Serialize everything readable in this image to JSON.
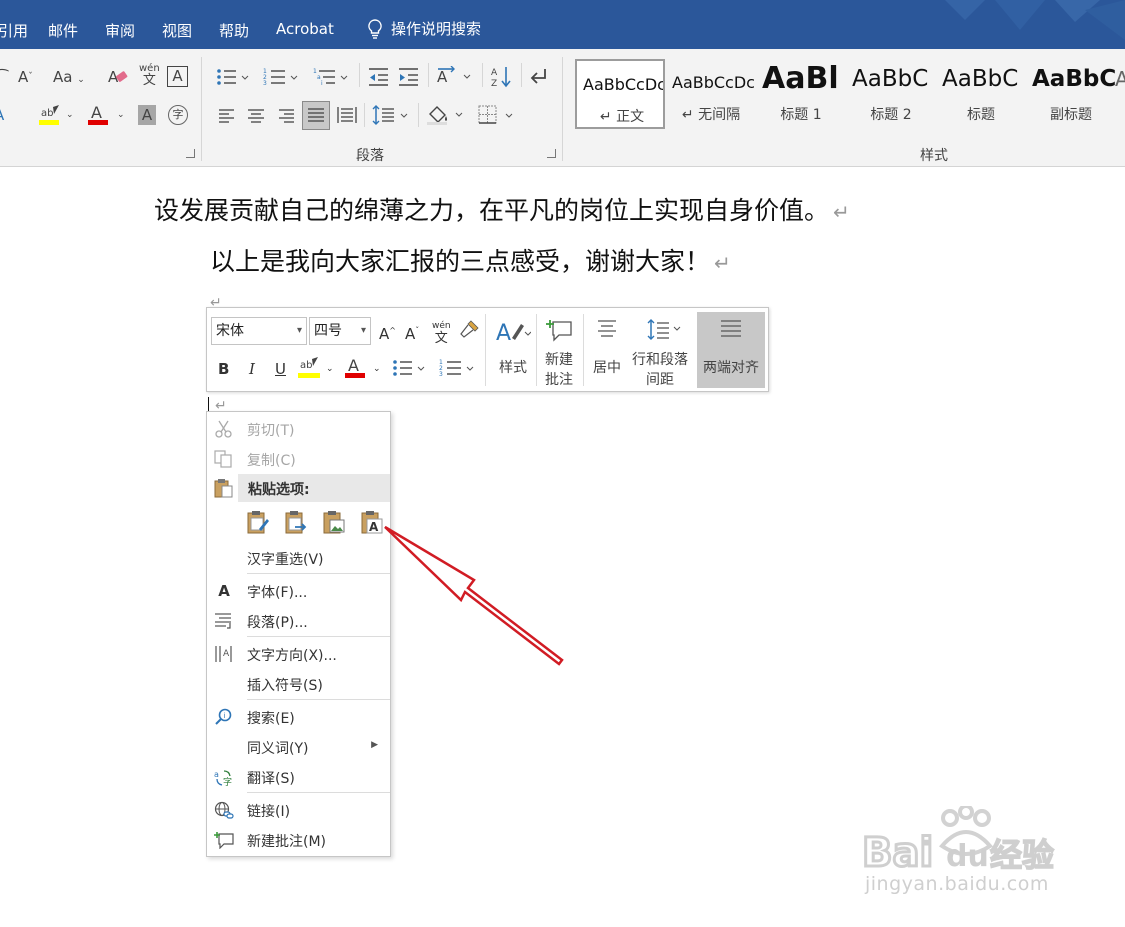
{
  "ribbon": {
    "tabs": [
      "引用",
      "邮件",
      "审阅",
      "视图",
      "帮助",
      "Acrobat"
    ],
    "tell_me": "操作说明搜索",
    "groups": {
      "paragraph_label": "段落",
      "styles_label": "样式"
    },
    "font_icons": {
      "shrink": "A",
      "case": "Aa",
      "pinyin_top": "wén",
      "pinyin_bottom": "文",
      "border_char": "A",
      "font_color": "A",
      "shade": "A",
      "enclose": "字"
    },
    "styles": [
      {
        "sample": "AaBbCcDc",
        "name": "↵ 正文",
        "selected": true
      },
      {
        "sample": "AaBbCcDc",
        "name": "↵ 无间隔",
        "selected": false
      },
      {
        "sample": "AaBl",
        "name": "标题 1",
        "selected": false
      },
      {
        "sample": "AaBbC",
        "name": "标题 2",
        "selected": false
      },
      {
        "sample": "AaBbC",
        "name": "标题",
        "selected": false
      },
      {
        "sample": "AaBbC",
        "name": "副标题",
        "selected": false
      }
    ]
  },
  "document": {
    "line1": "设发展贡献自己的绵薄之力，在平凡的岗位上实现自身价值。",
    "line2": "以上是我向大家汇报的三点感受，谢谢大家！",
    "para_mark": "↵"
  },
  "mini_toolbar": {
    "font_name": "宋体",
    "font_size": "四号",
    "grow": "A",
    "shrink": "A",
    "pinyin_top": "wén",
    "pinyin_bottom": "文",
    "bold": "B",
    "italic": "I",
    "underline": "U",
    "font_color": "A",
    "styles_label": "样式",
    "new_comment_label": "新建\n批注",
    "center_label": "居中",
    "spacing_label": "行和段落\n间距",
    "justify_label": "两端对齐"
  },
  "context_menu": {
    "cut": "剪切(T)",
    "copy": "复制(C)",
    "paste_options": "粘贴选项:",
    "reconvert": "汉字重选(V)",
    "font": "字体(F)...",
    "paragraph": "段落(P)...",
    "text_direction": "文字方向(X)...",
    "insert_symbol": "插入符号(S)",
    "search": "搜索(E)",
    "synonyms": "同义词(Y)",
    "translate": "翻译(S)",
    "link": "链接(I)",
    "new_comment": "新建批注(M)"
  },
  "watermark": {
    "logo_left": "Bai",
    "logo_mid": "du",
    "logo_right": "经验",
    "url": "jingyan.baidu.com"
  },
  "colors": {
    "ribbon_blue": "#2b579a",
    "ribbon_body": "#f3f3f3",
    "highlight_yellow": "#ffff00",
    "font_red": "#e00000",
    "arrow_red": "#d11c24"
  }
}
